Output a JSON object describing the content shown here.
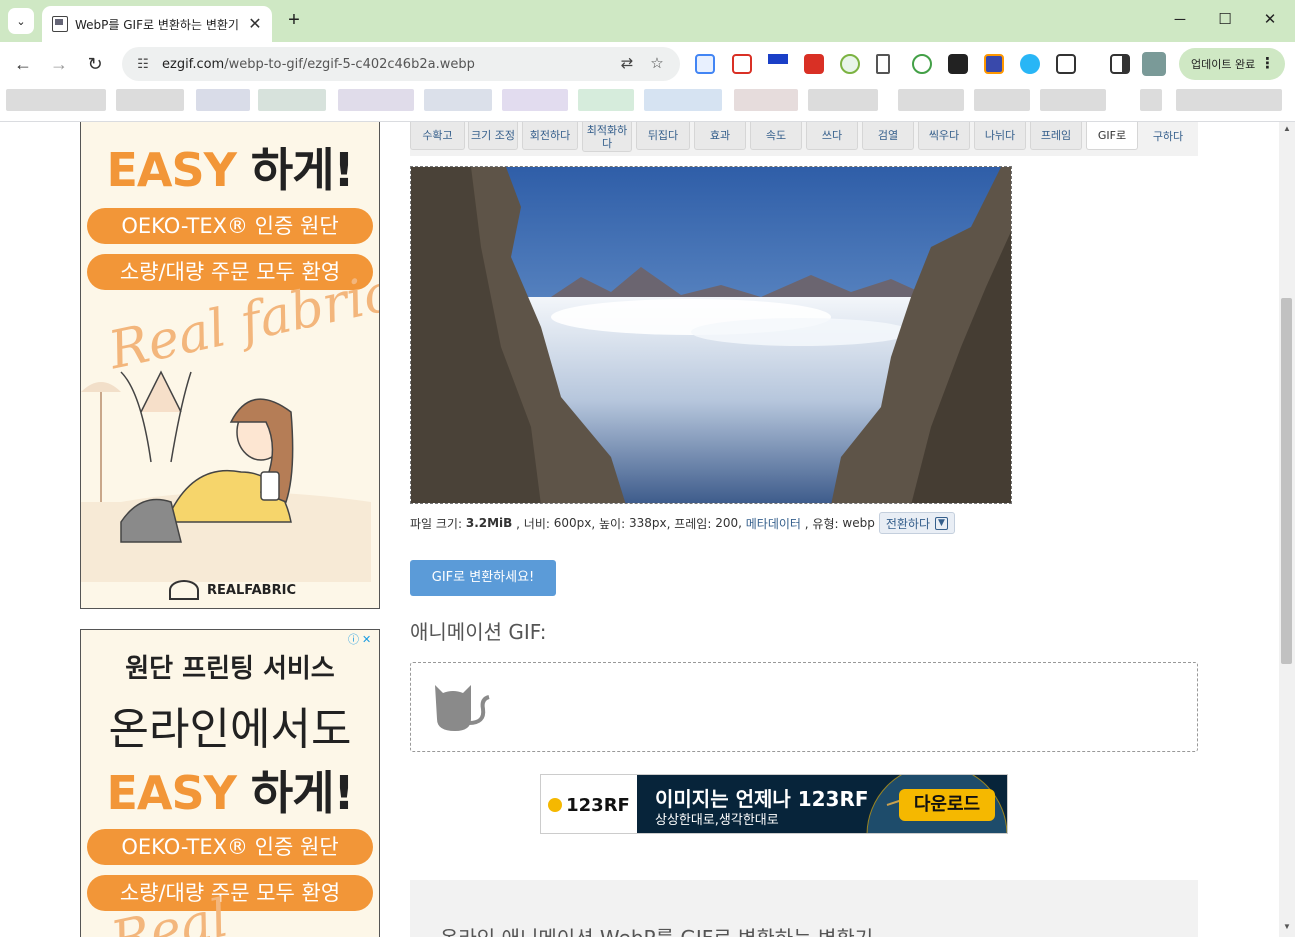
{
  "browser": {
    "tab_title": "WebP를 GIF로 변환하는 변환기",
    "tab_close": "✕",
    "new_tab": "+",
    "url_host": "ezgif.com",
    "url_path": "/webp-to-gif/ezgif-5-c402c46b2a.webp",
    "update_label": "업데이트 완료",
    "window": {
      "minimize": "─",
      "maximize": "☐",
      "close": "✕"
    }
  },
  "menu": {
    "items": [
      {
        "label": "수확고"
      },
      {
        "label": "크기 조정"
      },
      {
        "label": "회전하다"
      },
      {
        "label": "최적화하다"
      },
      {
        "label": "뒤집다"
      },
      {
        "label": "효과"
      },
      {
        "label": "속도"
      },
      {
        "label": "쓰다"
      },
      {
        "label": "검열"
      },
      {
        "label": "씩우다"
      },
      {
        "label": "나뉘다"
      },
      {
        "label": "프레임"
      },
      {
        "label": "GIF로"
      },
      {
        "label": "구하다"
      }
    ],
    "active_index": 12
  },
  "file_info": {
    "size_label": "파일 크기:",
    "size_value": "3.2MiB",
    "width_label": ", 너비:",
    "width_value": "600px",
    "height_label": ", 높이:",
    "height_value": "338px",
    "frames_label": ", 프레임:",
    "frames_value": "200",
    "metadata_label": "메타데이터",
    "type_label": ", 유형:",
    "type_value": "webp",
    "convert_label": "전환하다"
  },
  "convert_button": "GIF로 변환하세요!",
  "output": {
    "title": "애니메이션 GIF:"
  },
  "info_section": {
    "title": "온라인 애니메이션 WebP를 GIF로 변환하는 변환기"
  },
  "ads": {
    "ad1": {
      "easy": "EASY",
      "easy_suffix": "하게!",
      "pill1": "OEKO-TEX® 인증 원단",
      "pill2": "소량/대량 주문 모두 환영",
      "script": "Real fabric",
      "brand": "REALFABRIC"
    },
    "ad2": {
      "line1": "원단 프린팅 서비스",
      "line2": "온라인에서도",
      "easy": "EASY",
      "easy_suffix": "하게!",
      "pill1": "OEKO-TEX® 인증 원단",
      "pill2": "소량/대량 주문 모두 환영",
      "script": "Real"
    },
    "banner": {
      "logo": "123RF",
      "headline": "이미지는 언제나 123RF",
      "subline": "상상한대로,생각한대로",
      "cta": "다운로드"
    }
  },
  "colors": {
    "chrome_green": "#cfe8c4",
    "accent_orange": "#f29638",
    "button_blue": "#5b9bd8",
    "link_blue": "#355f8c"
  }
}
